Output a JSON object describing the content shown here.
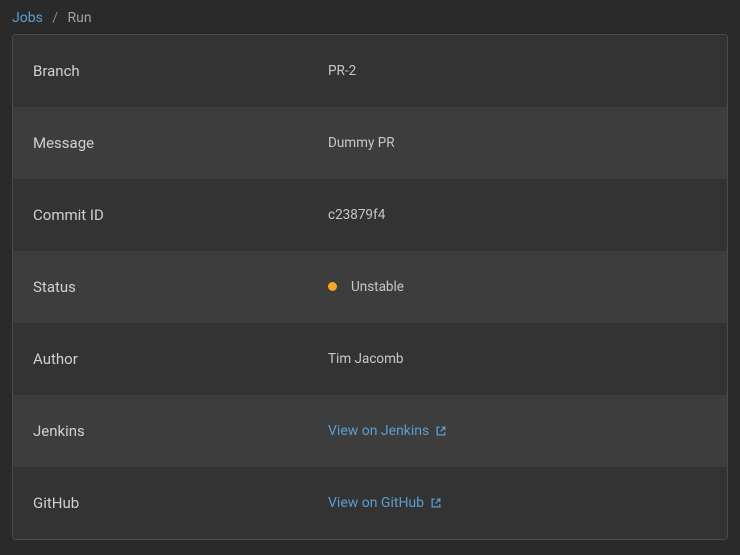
{
  "breadcrumb": {
    "root": "Jobs",
    "separator": "/",
    "current": "Run"
  },
  "rows": {
    "branch": {
      "label": "Branch",
      "value": "PR-2"
    },
    "message": {
      "label": "Message",
      "value": "Dummy PR"
    },
    "commit": {
      "label": "Commit ID",
      "value": "c23879f4"
    },
    "status": {
      "label": "Status",
      "value": "Unstable",
      "color": "#f5a623"
    },
    "author": {
      "label": "Author",
      "value": "Tim Jacomb"
    },
    "jenkins": {
      "label": "Jenkins",
      "link_text": "View on Jenkins"
    },
    "github": {
      "label": "GitHub",
      "link_text": "View on GitHub"
    }
  }
}
